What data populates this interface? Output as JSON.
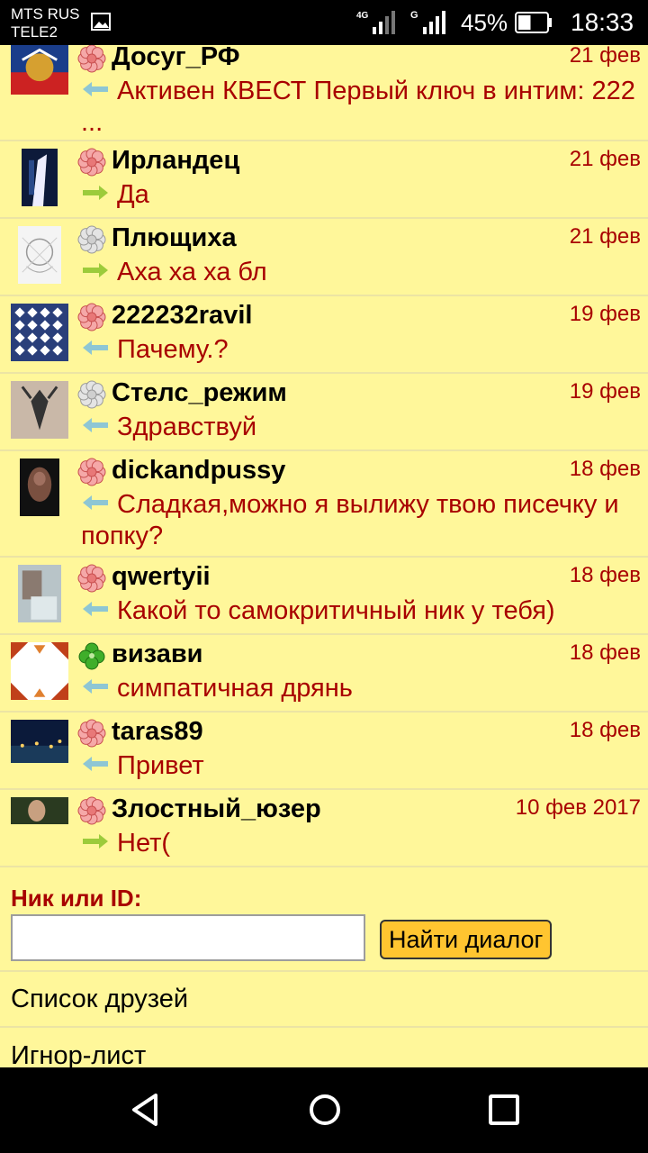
{
  "status_bar": {
    "carrier_line1": "MTS RUS",
    "carrier_line2": "TELE2",
    "net1_label": "4G",
    "net2_label": "G",
    "battery_percent": "45%",
    "battery_level": 0.45,
    "time": "18:33"
  },
  "dialogs": [
    {
      "name": "Досуг_РФ",
      "date": "21 фев",
      "direction": "incoming",
      "message": "Активен КВЕСТ Первый ключ в интим: 222 ...",
      "flower": "pink-flower-icon",
      "avatar": "flag-avatar"
    },
    {
      "name": "Ирландец",
      "date": "21 фев",
      "direction": "outgoing",
      "message": "Да",
      "flower": "pink-flower-icon",
      "avatar": "dark-blue-avatar"
    },
    {
      "name": "Плющиха",
      "date": "21 фев",
      "direction": "outgoing",
      "message": "Аха ха ха бл",
      "flower": "gray-flower-icon",
      "avatar": "sketch-avatar"
    },
    {
      "name": "222232ravil",
      "date": "19 фев",
      "direction": "incoming",
      "message": "Пачему.?",
      "flower": "pink-flower-icon",
      "avatar": "pattern-avatar"
    },
    {
      "name": "Стелс_режим",
      "date": "19 фев",
      "direction": "incoming",
      "message": "Здравствуй",
      "flower": "gray-flower-icon",
      "avatar": "tattoo-avatar"
    },
    {
      "name": "dickandpussy",
      "date": "18 фев",
      "direction": "incoming",
      "message": "Сладкая,можно я вылижу твою писечку и попку?",
      "flower": "pink-flower-icon",
      "avatar": "dark-photo-avatar"
    },
    {
      "name": "qwertyii",
      "date": "18 фев",
      "direction": "incoming",
      "message": "Какой то самокритичный ник у тебя)",
      "flower": "pink-flower-icon",
      "avatar": "selfie-avatar"
    },
    {
      "name": "визави",
      "date": "18 фев",
      "direction": "incoming",
      "message": "симпатичная дрянь",
      "flower": "green-clover-icon",
      "avatar": "triangles-avatar"
    },
    {
      "name": "taras89",
      "date": "18 фев",
      "direction": "incoming",
      "message": "Привет",
      "flower": "pink-flower-icon",
      "avatar": "city-lights-avatar"
    },
    {
      "name": "Злостный_юзер",
      "date": "10 фев 2017",
      "direction": "outgoing",
      "message": "Нет(",
      "flower": "pink-flower-icon",
      "avatar": "green-photo-avatar"
    }
  ],
  "search": {
    "label": "Ник или ID:",
    "input_value": "",
    "button_label": "Найти диалог"
  },
  "links": {
    "friends": "Список друзей",
    "ignore": "Игнор-лист"
  },
  "nav": [
    "back-icon",
    "home-icon",
    "recents-icon"
  ],
  "colors": {
    "background": "#fff79a",
    "text_red": "#a80000",
    "button_orange": "#ffc530",
    "incoming_arrow": "#8ec6d4",
    "outgoing_arrow": "#9ccb3b"
  }
}
